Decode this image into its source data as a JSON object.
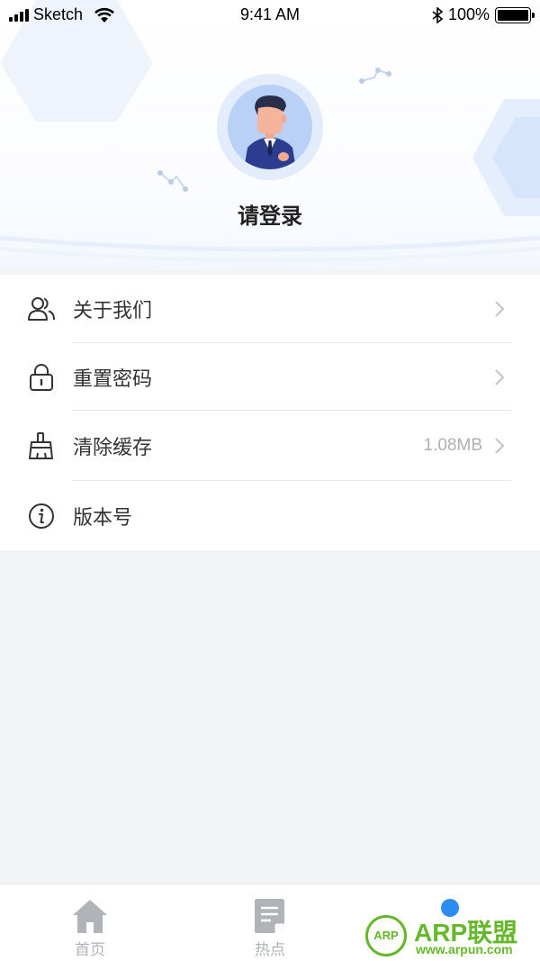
{
  "status_bar": {
    "carrier": "Sketch",
    "time": "9:41 AM",
    "battery": "100%"
  },
  "profile": {
    "login_prompt": "请登录"
  },
  "menu": {
    "items": [
      {
        "label": "关于我们",
        "icon": "users-icon"
      },
      {
        "label": "重置密码",
        "icon": "lock-icon"
      },
      {
        "label": "清除缓存",
        "icon": "broom-icon",
        "value": "1.08MB"
      },
      {
        "label": "版本号",
        "icon": "info-icon"
      }
    ]
  },
  "tabbar": {
    "tabs": [
      {
        "label": "首页",
        "icon": "home-icon"
      },
      {
        "label": "热点",
        "icon": "document-icon"
      },
      {
        "label": "",
        "icon": "profile-dot-icon"
      }
    ]
  },
  "watermark": {
    "circle_text": "ARP",
    "title": "ARP联盟",
    "url": "www.arpun.com"
  },
  "colors": {
    "accent": "#2d8cf0",
    "watermark": "#65b82a",
    "tab_inactive": "#b0b3b8"
  }
}
